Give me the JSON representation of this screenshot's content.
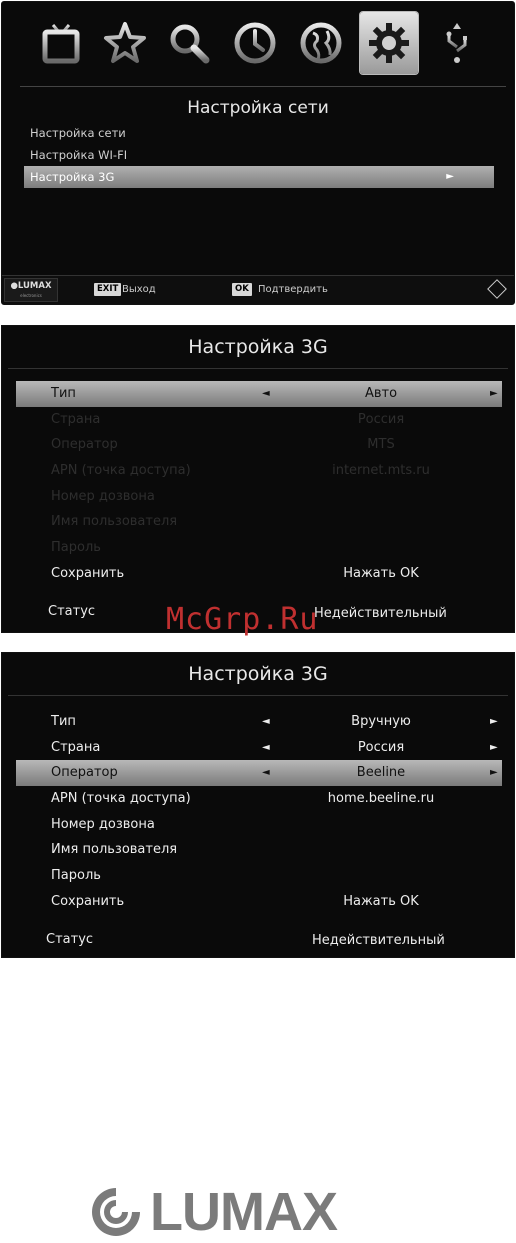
{
  "screen1": {
    "title": "Настройка сети",
    "icons": [
      "tv-icon",
      "star-icon",
      "search-icon",
      "clock-icon",
      "globe-icon",
      "gear-icon",
      "usb-icon"
    ],
    "selected_icon": "gear-icon",
    "menu": [
      {
        "label": "Настройка сети",
        "selected": false
      },
      {
        "label": "Настройка WI-FI",
        "selected": false
      },
      {
        "label": "Настройка 3G",
        "selected": true,
        "arrow": "►"
      }
    ],
    "footer": {
      "logo": "●LUMAX",
      "logo_sub": "electronics",
      "exit_key": "EXIT",
      "exit_label": "Выход",
      "ok_key": "OK",
      "ok_label": "Подтвердить"
    }
  },
  "screen2": {
    "title": "Настройка 3G",
    "rows": [
      {
        "label": "Тип",
        "value": "Авто",
        "left_arrow": "◄",
        "right_arrow": "►",
        "state": "selected"
      },
      {
        "label": "Страна",
        "value": "Россия",
        "state": "disabled"
      },
      {
        "label": "Оператор",
        "value": "MTS",
        "state": "disabled"
      },
      {
        "label": "APN (точка доступа)",
        "value": "internet.mts.ru",
        "state": "disabled"
      },
      {
        "label": "Номер дозвона",
        "value": "",
        "state": "disabled"
      },
      {
        "label": "Имя пользователя",
        "value": "",
        "state": "disabled"
      },
      {
        "label": "Пароль",
        "value": "",
        "state": "disabled"
      },
      {
        "label": "Сохранить",
        "value": "Нажать OK",
        "state": "normal"
      }
    ],
    "status_label": "Статус",
    "status_value": "Недействительный"
  },
  "screen3": {
    "title": "Настройка 3G",
    "rows": [
      {
        "label": "Тип",
        "value": "Вручную",
        "left_arrow": "◄",
        "right_arrow": "►",
        "state": "normal"
      },
      {
        "label": "Страна",
        "value": "Россия",
        "left_arrow": "◄",
        "right_arrow": "►",
        "state": "normal"
      },
      {
        "label": "Оператор",
        "value": "Beeline",
        "left_arrow": "◄",
        "right_arrow": "►",
        "state": "selected"
      },
      {
        "label": "APN (точка доступа)",
        "value": "home.beeline.ru",
        "state": "normal"
      },
      {
        "label": "Номер дозвона",
        "value": "",
        "state": "normal"
      },
      {
        "label": "Имя пользователя",
        "value": "",
        "state": "normal"
      },
      {
        "label": "Пароль",
        "value": "",
        "state": "normal"
      },
      {
        "label": "Сохранить",
        "value": "Нажать OK",
        "state": "normal"
      }
    ],
    "status_label": "Статус",
    "status_value": "Недействительный"
  },
  "watermark": "McGrp.Ru",
  "brand": "LUMAX",
  "colors": {
    "panel_bg": "#0a0a0a",
    "highlight": "#9c9c9c",
    "brand_gray": "#7b7b7b",
    "watermark": "#c03030"
  }
}
